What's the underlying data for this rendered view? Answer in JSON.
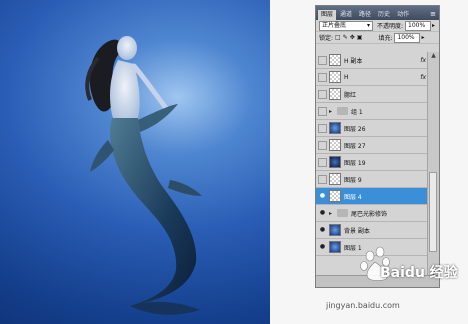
{
  "panel": {
    "tabs": [
      "图层",
      "通道",
      "路径",
      "历史",
      "动作"
    ],
    "blend_mode": "正片叠底",
    "opacity_label": "不透明度:",
    "opacity_value": "100%",
    "lock_label": "锁定:",
    "fill_label": "填充:",
    "fill_value": "100%"
  },
  "layers": [
    {
      "name": "H 副本",
      "thumb": "checker",
      "fx": "fx",
      "visible": false
    },
    {
      "name": "H",
      "thumb": "checker",
      "fx": "fx",
      "visible": false
    },
    {
      "name": "腮红",
      "thumb": "checker",
      "fx": "",
      "visible": false
    },
    {
      "name": "组 1",
      "thumb": "folder",
      "fx": "",
      "visible": false
    },
    {
      "name": "图层 26",
      "thumb": "blue",
      "fx": "",
      "visible": false
    },
    {
      "name": "图层 27",
      "thumb": "checker",
      "fx": "",
      "visible": false
    },
    {
      "name": "图层 19",
      "thumb": "dark",
      "fx": "",
      "visible": false
    },
    {
      "name": "图层 9",
      "thumb": "checker",
      "fx": "",
      "visible": false
    },
    {
      "name": "图层 4",
      "thumb": "checker",
      "fx": "",
      "visible": true,
      "selected": true
    },
    {
      "name": "尾巴光影修饰",
      "thumb": "folder",
      "fx": "",
      "visible": true
    },
    {
      "name": "背景 副本",
      "thumb": "blue",
      "fx": "",
      "visible": true
    },
    {
      "name": "图层 1",
      "thumb": "blue",
      "fx": "",
      "visible": true
    }
  ],
  "watermark": {
    "brand": "Baidu 经验",
    "url": "jingyan.baidu.com"
  },
  "icons": {
    "eye": "eye-icon",
    "expand": "triangle-right-icon",
    "menu": "panel-menu-icon"
  }
}
